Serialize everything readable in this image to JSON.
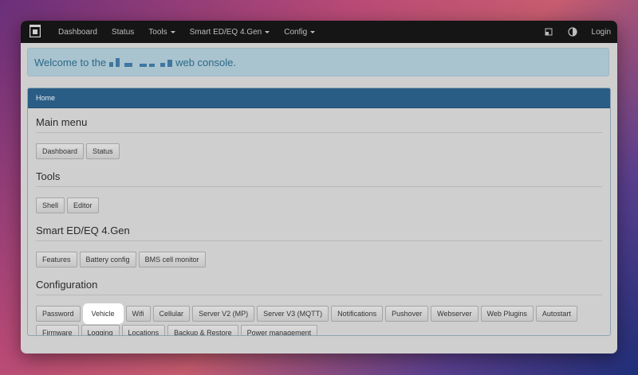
{
  "navbar": {
    "items": [
      {
        "label": "Dashboard",
        "dropdown": false
      },
      {
        "label": "Status",
        "dropdown": false
      },
      {
        "label": "Tools",
        "dropdown": true
      },
      {
        "label": "Smart ED/EQ 4.Gen",
        "dropdown": true
      },
      {
        "label": "Config",
        "dropdown": true
      }
    ],
    "icons": [
      "window-icon",
      "contrast-icon"
    ],
    "login_label": "Login"
  },
  "welcome": {
    "prefix": "Welcome to the",
    "suffix": "web console."
  },
  "panel": {
    "breadcrumb": "Home",
    "sections": [
      {
        "title": "Main menu",
        "buttons": [
          "Dashboard",
          "Status"
        ]
      },
      {
        "title": "Tools",
        "buttons": [
          "Shell",
          "Editor"
        ]
      },
      {
        "title": "Smart ED/EQ 4.Gen",
        "buttons": [
          "Features",
          "Battery config",
          "BMS cell monitor"
        ]
      },
      {
        "title": "Configuration",
        "buttons": [
          "Password",
          "Vehicle",
          "Wifi",
          "Cellular",
          "Server V2 (MP)",
          "Server V3 (MQTT)",
          "Notifications",
          "Pushover",
          "Webserver",
          "Web Plugins",
          "Autostart",
          "Firmware",
          "Logging",
          "Locations",
          "Backup & Restore",
          "Power management"
        ],
        "highlighted": "Vehicle"
      }
    ]
  },
  "colors": {
    "navbar_bg": "#151515",
    "panel_head_bg": "#2a5d86",
    "welcome_bg": "#a9c3cf",
    "welcome_text": "#2b6a87"
  }
}
